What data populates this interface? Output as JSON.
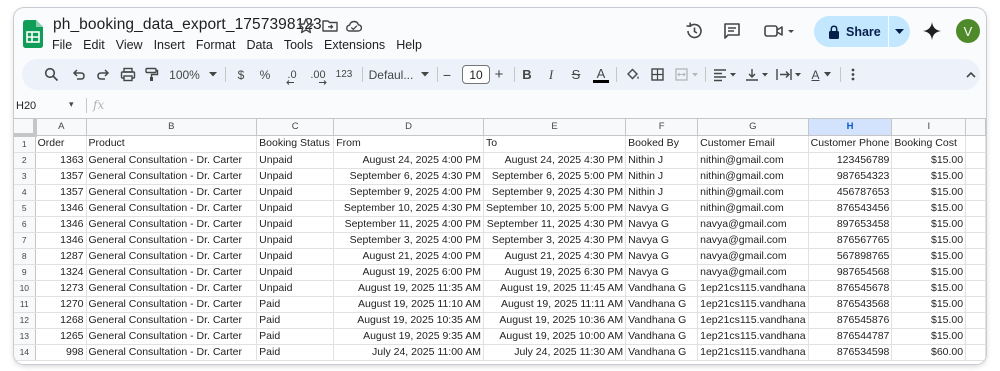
{
  "doc": {
    "title": "ph_booking_data_export_1757398123"
  },
  "menu": [
    "File",
    "Edit",
    "View",
    "Insert",
    "Format",
    "Data",
    "Tools",
    "Extensions",
    "Help"
  ],
  "share": {
    "label": "Share"
  },
  "user": {
    "initial": "V"
  },
  "toolbar": {
    "zoom": "100%",
    "currency": "$",
    "percent": "%",
    "dec_decrease": ".0",
    "dec_increase": ".00",
    "format_123": "123",
    "font_family": "Defaul...",
    "font_size": "10",
    "minus": "−",
    "plus": "+",
    "bold": "B",
    "italic": "I",
    "strike": "S",
    "text_color": "A",
    "text_rotate": "A"
  },
  "formula_bar": {
    "cell_ref": "H20",
    "fx": "fx"
  },
  "grid": {
    "columns": [
      "A",
      "B",
      "C",
      "D",
      "E",
      "F",
      "G",
      "H",
      "I"
    ],
    "active_column": "H",
    "headers": [
      "Order",
      "Product",
      "Booking Status",
      "From",
      "To",
      "Booked By",
      "Customer Email",
      "Customer Phone",
      "Booking Cost"
    ],
    "rows": [
      [
        "1363",
        "General Consultation - Dr. Carter",
        "Unpaid",
        "August 24, 2025 4:00 PM",
        "August 24, 2025 4:30 PM",
        "Nithin J",
        "nithin@gmail.com",
        "123456789",
        "$15.00"
      ],
      [
        "1357",
        "General Consultation - Dr. Carter",
        "Unpaid",
        "September 6, 2025 4:30 PM",
        "September 6, 2025 5:00 PM",
        "Nithin J",
        "nithin@gmail.com",
        "987654323",
        "$15.00"
      ],
      [
        "1357",
        "General Consultation - Dr. Carter",
        "Unpaid",
        "September 9, 2025 4:00 PM",
        "September 9, 2025 4:30 PM",
        "Nithin J",
        "nithin@gmail.com",
        "456787653",
        "$15.00"
      ],
      [
        "1346",
        "General Consultation - Dr. Carter",
        "Unpaid",
        "September 10, 2025 4:30 PM",
        "September 10, 2025 5:00 PM",
        "Navya G",
        "nithin@gmail.com",
        "876543456",
        "$15.00"
      ],
      [
        "1346",
        "General Consultation - Dr. Carter",
        "Unpaid",
        "September 11, 2025 4:00 PM",
        "September 11, 2025 4:30 PM",
        "Navya G",
        "navya@gmail.com",
        "897653458",
        "$15.00"
      ],
      [
        "1346",
        "General Consultation - Dr. Carter",
        "Unpaid",
        "September 3, 2025 4:00 PM",
        "September 3, 2025 4:30 PM",
        "Navya G",
        "navya@gmail.com",
        "876567765",
        "$15.00"
      ],
      [
        "1287",
        "General Consultation - Dr. Carter",
        "Unpaid",
        "August 21, 2025 4:00 PM",
        "August 21, 2025 4:30 PM",
        "Navya G",
        "navya@gmail.com",
        "567898765",
        "$15.00"
      ],
      [
        "1324",
        "General Consultation - Dr. Carter",
        "Unpaid",
        "August 19, 2025 6:00 PM",
        "August 19, 2025 6:30 PM",
        "Navya G",
        "navya@gmail.com",
        "987654568",
        "$15.00"
      ],
      [
        "1273",
        "General Consultation - Dr. Carter",
        "Unpaid",
        "August 19, 2025 11:35 AM",
        "August 19, 2025 11:45 AM",
        "Vandhana G",
        "1ep21cs115.vandhana",
        "876545678",
        "$15.00"
      ],
      [
        "1270",
        "General Consultation - Dr. Carter",
        "Paid",
        "August 19, 2025 11:10 AM",
        "August 19, 2025 11:11 AM",
        "Vandhana G",
        "1ep21cs115.vandhana",
        "876543568",
        "$15.00"
      ],
      [
        "1268",
        "General Consultation - Dr. Carter",
        "Paid",
        "August 19, 2025 10:35 AM",
        "August 19, 2025 10:36 AM",
        "Vandhana G",
        "1ep21cs115.vandhana",
        "876545876",
        "$15.00"
      ],
      [
        "1265",
        "General Consultation - Dr. Carter",
        "Paid",
        "August 19, 2025 9:35 AM",
        "August 19, 2025 10:00 AM",
        "Vandhana G",
        "1ep21cs115.vandhana",
        "876544787",
        "$15.00"
      ],
      [
        "998",
        "General Consultation - Dr. Carter",
        "Paid",
        "July 24, 2025 11:00 AM",
        "July 24, 2025 11:30 AM",
        "Vandhana G",
        "1ep21cs115.vandhana",
        "876534598",
        "$60.00"
      ]
    ]
  },
  "colors": {
    "accent": "#0b57d0",
    "share_bg": "#c2e7ff",
    "logo": "#0f9d58",
    "avatar": "#4e8a2a"
  }
}
